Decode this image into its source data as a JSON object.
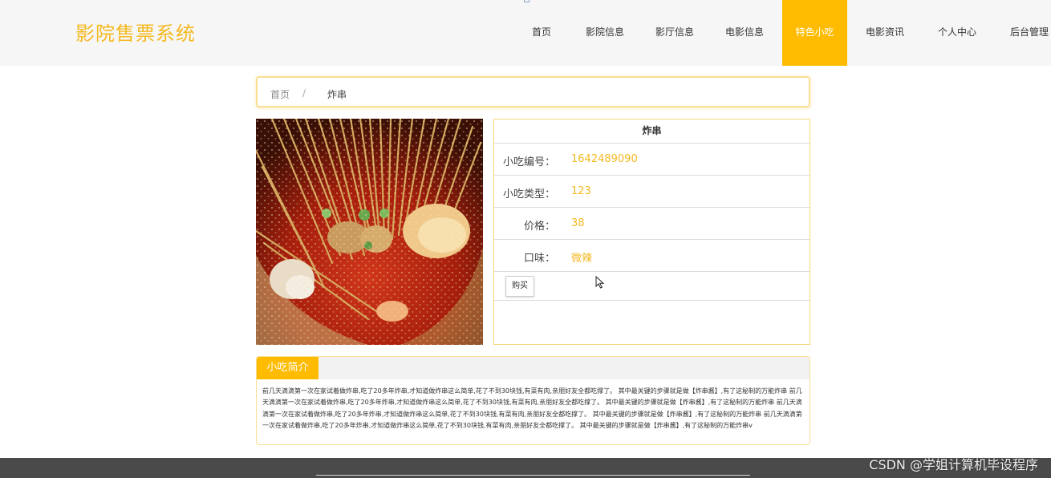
{
  "header": {
    "logo": "影院售票系统",
    "nav": [
      {
        "label": "首页",
        "name": "nav-home"
      },
      {
        "label": "影院信息",
        "name": "nav-cinema-info"
      },
      {
        "label": "影厅信息",
        "name": "nav-hall-info"
      },
      {
        "label": "电影信息",
        "name": "nav-movie-info"
      },
      {
        "label": "特色小吃",
        "name": "nav-snacks",
        "active": true
      },
      {
        "label": "电影资讯",
        "name": "nav-movie-news"
      },
      {
        "label": "个人中心",
        "name": "nav-personal-center"
      },
      {
        "label": "后台管理",
        "name": "nav-admin"
      }
    ]
  },
  "breadcrumb": {
    "home": "首页",
    "separator": "/",
    "current": "炸串"
  },
  "detail": {
    "title": "炸串",
    "rows": [
      {
        "label": "小吃编号：",
        "value": "1642489090"
      },
      {
        "label": "小吃类型：",
        "value": "123"
      },
      {
        "label": "价格：",
        "value": "38"
      },
      {
        "label": "口味：",
        "value": "微辣"
      }
    ],
    "buy_label": "购买"
  },
  "intro": {
    "heading": "小吃简介",
    "text": "前几天滴滴第一次在家试着做炸串,吃了20多年炸串,才知道做炸串这么简单,花了不到30块钱,有菜有肉,亲朋好友全都吃撑了。 其中最关键的步骤就是做【炸串酱】,有了这秘制的万能炸串 前几天滴滴第一次在家试着做炸串,吃了20多年炸串,才知道做炸串这么简单,花了不到30块钱,有菜有肉,亲朋好友全都吃撑了。 其中最关键的步骤就是做【炸串酱】,有了这秘制的万能炸串 前几天滴滴第一次在家试着做炸串,吃了20多年炸串,才知道做炸串这么简单,花了不到30块钱,有菜有肉,亲朋好友全都吃撑了。 其中最关键的步骤就是做【炸串酱】,有了这秘制的万能炸串 前几天滴滴第一次在家试着做炸串,吃了20多年炸串,才知道做炸串这么简单,花了不到30块钱,有菜有肉,亲朋好友全都吃撑了。 其中最关键的步骤就是做【炸串酱】,有了这秘制的万能炸串v"
  },
  "watermark": "CSDN @学姐计算机毕设程序",
  "colors": {
    "accent": "#ffbb00",
    "logo": "#f5b921",
    "value": "#f5b921",
    "footer": "#4a4a4a"
  }
}
